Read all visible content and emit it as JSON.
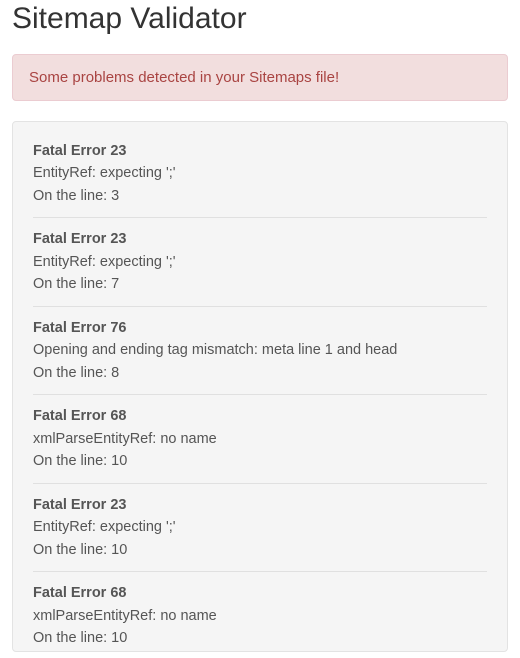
{
  "page": {
    "title": "Sitemap Validator",
    "alert_message": "Some problems detected in your Sitemaps file!"
  },
  "errors": [
    {
      "title": "Fatal Error 23",
      "message": "EntityRef: expecting ';'",
      "line_text": "On the line: 3"
    },
    {
      "title": "Fatal Error 23",
      "message": "EntityRef: expecting ';'",
      "line_text": "On the line: 7"
    },
    {
      "title": "Fatal Error 76",
      "message": "Opening and ending tag mismatch: meta line 1 and head",
      "line_text": "On the line: 8"
    },
    {
      "title": "Fatal Error 68",
      "message": "xmlParseEntityRef: no name",
      "line_text": "On the line: 10"
    },
    {
      "title": "Fatal Error 23",
      "message": "EntityRef: expecting ';'",
      "line_text": "On the line: 10"
    },
    {
      "title": "Fatal Error 68",
      "message": "xmlParseEntityRef: no name",
      "line_text": "On the line: 10"
    }
  ]
}
